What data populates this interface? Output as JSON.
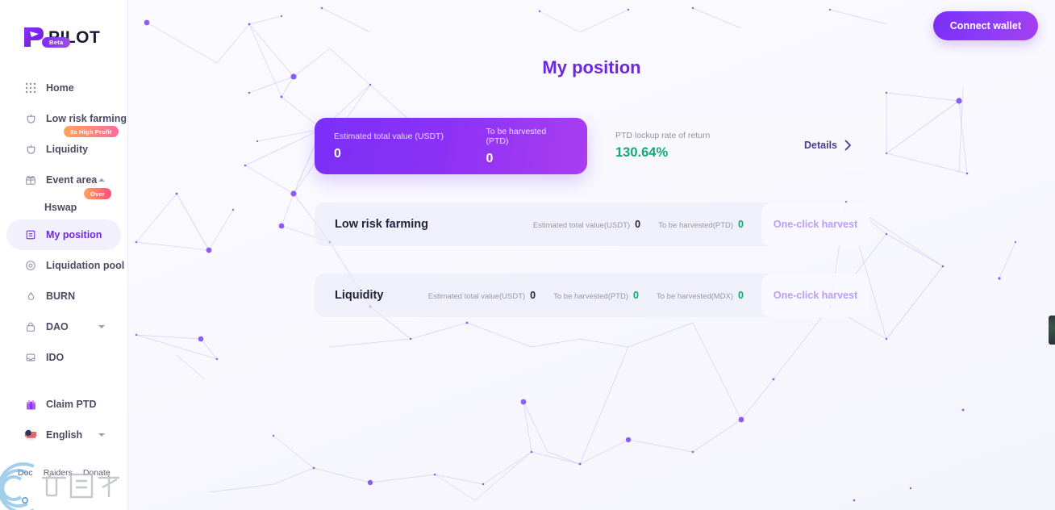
{
  "brand": {
    "name": "PILOT",
    "badge": "Beta",
    "logo_icon": "pilot-logo-icon",
    "accent": "#7b2ff7"
  },
  "sidebar": {
    "items": [
      {
        "label": "Home",
        "icon": "grid-icon",
        "active": false,
        "badge": null,
        "caret": null
      },
      {
        "label": "Low risk farming",
        "icon": "shield-crop-icon",
        "active": false,
        "badge": null,
        "caret": null
      },
      {
        "label": "Liquidity",
        "icon": "shield-crop-icon",
        "active": false,
        "badge": "3x High Profit",
        "caret": null
      },
      {
        "label": "Event area",
        "icon": "gift-icon",
        "active": false,
        "badge": null,
        "caret": "up"
      },
      {
        "label": "My position",
        "icon": "document-icon",
        "active": true,
        "badge": null,
        "caret": null
      },
      {
        "label": "Liquidation pool",
        "icon": "target-icon",
        "active": false,
        "badge": null,
        "caret": null
      },
      {
        "label": "BURN",
        "icon": "flame-icon",
        "active": false,
        "badge": null,
        "caret": null
      },
      {
        "label": "DAO",
        "icon": "lock-icon",
        "active": false,
        "badge": null,
        "caret": "down"
      },
      {
        "label": "IDO",
        "icon": "inbox-icon",
        "active": false,
        "badge": null,
        "caret": null
      }
    ],
    "sub_item": {
      "label": "Hswap",
      "badge": "Over"
    },
    "claim": {
      "label": "Claim PTD",
      "icon": "gift-box-icon"
    },
    "language": {
      "label": "English",
      "icon": "us-flag-icon",
      "caret": "down"
    },
    "footer_links": [
      "Doc",
      "Raiders",
      "Donate"
    ]
  },
  "header": {
    "connect_wallet": "Connect wallet",
    "page_title": "My position"
  },
  "summary": {
    "estimated_total_label": "Estimated total value (USDT)",
    "estimated_total_value": "0",
    "to_be_harvested_label": "To be harvested (PTD)",
    "to_be_harvested_value": "0",
    "roi_label": "PTD lockup rate of return",
    "roi_value": "130.64%",
    "roi_color": "#12a970",
    "details_label": "Details",
    "details_icon": "chevron-right-icon"
  },
  "pools": [
    {
      "name": "Low risk farming",
      "stats": [
        {
          "label": "Estimated total value(USDT)",
          "value": "0",
          "tone": "dark"
        },
        {
          "label": "To be harvested(PTD)",
          "value": "0",
          "tone": "green"
        }
      ],
      "action": "One-click harvest"
    },
    {
      "name": "Liquidity",
      "stats": [
        {
          "label": "Estimated total value(USDT)",
          "value": "0",
          "tone": "dark"
        },
        {
          "label": "To be harvested(PTD)",
          "value": "0",
          "tone": "green"
        },
        {
          "label": "To be harvested(MDX)",
          "value": "0",
          "tone": "green"
        }
      ],
      "action": "One-click harvest"
    }
  ]
}
